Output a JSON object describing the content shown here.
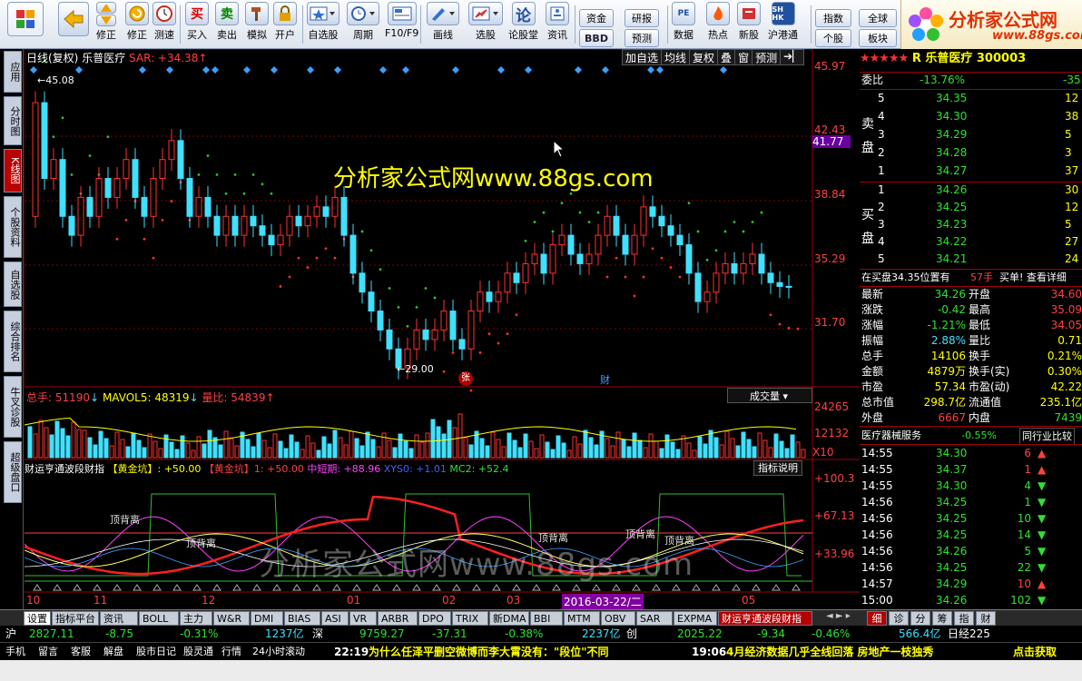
{
  "toolbar": {
    "buttons": [
      {
        "label": "修正",
        "icon": "up-down-icon"
      },
      {
        "label": "测速",
        "icon": "clock-icon"
      },
      {
        "label": "买入",
        "icon": "buy-icon"
      },
      {
        "label": "卖出",
        "icon": "sell-icon"
      },
      {
        "label": "模拟",
        "icon": "hammer-icon"
      },
      {
        "label": "开户",
        "icon": "lock-icon"
      },
      {
        "label": "自选股",
        "icon": "star-icon"
      },
      {
        "label": "周期",
        "icon": "period-icon"
      },
      {
        "label": "F10/F9",
        "icon": "f10-icon"
      },
      {
        "label": "画线",
        "icon": "pen-icon"
      },
      {
        "label": "选股",
        "icon": "select-icon"
      },
      {
        "label": "论股堂",
        "icon": "lun-icon"
      },
      {
        "label": "资讯",
        "icon": "news-icon"
      },
      {
        "label": "数据",
        "icon": "data-icon"
      },
      {
        "label": "热点",
        "icon": "hot-icon"
      },
      {
        "label": "新股",
        "icon": "newstock-icon"
      },
      {
        "label": "沪港通",
        "icon": "hk-icon"
      }
    ],
    "buy_glyph": "买",
    "sell_glyph": "卖",
    "lun_glyph": "论",
    "bbd_glyph": "BBD",
    "small_buttons": {
      "zijin": "资金",
      "yanbao": "研报",
      "bbd": "BBD",
      "yuce": "预测",
      "zhishu": "指数",
      "quanqiu": "全球",
      "gegu": "个股",
      "bankuai": "板块"
    },
    "logo_text": "分析家公式网",
    "logo_url": "www.88gs.com"
  },
  "left_strip": [
    "应用",
    "分时图",
    "K线图",
    "个股资料",
    "自选股",
    "综合排名",
    "牛叉诊股",
    "超级盘口"
  ],
  "chart": {
    "header": {
      "period": "日线(复权)",
      "name": "乐普医疗",
      "sar": "SAR: +34.38"
    },
    "buttons": [
      "加自选",
      "均线",
      "复权",
      "叠",
      "窗",
      "预测"
    ],
    "price_axis": [
      "45.97",
      "42.43",
      "41.77",
      "38.84",
      "35.29",
      "31.70"
    ],
    "high_label": "45.08",
    "low_label": "29.00",
    "watermark": "分析家公式网www.88gs.com",
    "watermark2": "分析家公式网www.88gs.com",
    "zhang_badge": "张",
    "cai_badge": "财",
    "vol_header": {
      "total": "总手: 51190",
      "mavol": "MAVOL5: 48319",
      "ratio": "量比: 54839"
    },
    "vol_selector": "成交量",
    "vol_axis": [
      "24265",
      "12132",
      "X10"
    ],
    "ind_header": {
      "name": "财运亨通波段财指",
      "a": "【黄金坑】: +50.00",
      "b": "【黄金坑】1: +50.00",
      "c": "中短期: +88.96",
      "d": "XYS0: +1.01",
      "e": "MC2: +52.4"
    },
    "ind_button": "指标说明",
    "ind_axis": [
      "+100.3",
      "+67.13",
      "+33.96"
    ],
    "ind_labels": [
      "顶背离",
      "顶背离",
      "顶背离",
      "顶背离",
      "顶背离"
    ],
    "date_axis": [
      "10",
      "11",
      "12",
      "01",
      "02",
      "03",
      "05"
    ],
    "date_highlight": "2016-03-22/二"
  },
  "chart_data": {
    "type": "candlestick",
    "title": "乐普医疗 日线(复权)",
    "price_range": [
      29.0,
      45.97
    ],
    "high": 45.08,
    "low": 29.0,
    "indicator_range": [
      0,
      100.3
    ],
    "x_ticks": [
      "10",
      "11",
      "12",
      "01",
      "02",
      "03",
      "05"
    ]
  },
  "right_panel": {
    "title": "R 乐普医疗",
    "code": "300003",
    "weibi_label": "委比",
    "weibi": "-13.76%",
    "weicha": "-35",
    "sell": [
      {
        "lvl": "5",
        "p": "34.35",
        "v": "12"
      },
      {
        "lvl": "4",
        "p": "34.30",
        "v": "38"
      },
      {
        "lvl": "3",
        "p": "34.29",
        "v": "5"
      },
      {
        "lvl": "2",
        "p": "34.28",
        "v": "3"
      },
      {
        "lvl": "1",
        "p": "34.27",
        "v": "37"
      }
    ],
    "buy": [
      {
        "lvl": "1",
        "p": "34.26",
        "v": "30"
      },
      {
        "lvl": "2",
        "p": "34.25",
        "v": "12"
      },
      {
        "lvl": "3",
        "p": "34.23",
        "v": "5"
      },
      {
        "lvl": "4",
        "p": "34.22",
        "v": "27"
      },
      {
        "lvl": "5",
        "p": "34.21",
        "v": "24"
      }
    ],
    "sell_label": "卖盘",
    "buy_label": "买盘",
    "notice": "在买盘34.35位置有",
    "notice_v": "57手",
    "notice_btn": "买单! 查看详细",
    "stats": [
      [
        "最新",
        "34.26",
        "开盘",
        "34.60"
      ],
      [
        "涨跌",
        "-0.42",
        "最高",
        "35.09"
      ],
      [
        "涨幅",
        "-1.21%",
        "最低",
        "34.05"
      ],
      [
        "振幅",
        "2.88%",
        "量比",
        "0.71"
      ],
      [
        "总手",
        "14106",
        "换手",
        "0.21%"
      ],
      [
        "金额",
        "4879万",
        "换手(实)",
        "0.30%"
      ],
      [
        "市盈",
        "57.34",
        "市盈(动)",
        "42.22"
      ],
      [
        "总市值",
        "298.7亿",
        "流通值",
        "235.1亿"
      ],
      [
        "外盘",
        "6667",
        "内盘",
        "7439"
      ]
    ],
    "industry": "医疗器械服务",
    "industry_chg": "-0.55%",
    "industry_btn": "同行业比较",
    "ticks": [
      {
        "t": "14:55",
        "p": "34.30",
        "v": "6",
        "d": "up"
      },
      {
        "t": "14:55",
        "p": "34.37",
        "v": "1",
        "d": "up"
      },
      {
        "t": "14:55",
        "p": "34.30",
        "v": "4",
        "d": "down"
      },
      {
        "t": "14:56",
        "p": "34.25",
        "v": "1",
        "d": "down"
      },
      {
        "t": "14:56",
        "p": "34.25",
        "v": "10",
        "d": "down"
      },
      {
        "t": "14:56",
        "p": "34.25",
        "v": "14",
        "d": "down"
      },
      {
        "t": "14:56",
        "p": "34.26",
        "v": "5",
        "d": "down"
      },
      {
        "t": "14:56",
        "p": "34.25",
        "v": "22",
        "d": "down"
      },
      {
        "t": "14:57",
        "p": "34.29",
        "v": "10",
        "d": "up"
      },
      {
        "t": "15:00",
        "p": "34.26",
        "v": "102",
        "d": "down"
      }
    ],
    "bottom_tabs": [
      "细",
      "诊",
      "分",
      "筹",
      "指",
      "财"
    ]
  },
  "tabs": [
    "设置",
    "指标平台",
    "资讯",
    "BOLL",
    "主力",
    "W&R",
    "DMI",
    "BIAS",
    "ASI",
    "VR",
    "ARBR",
    "DPO",
    "TRIX",
    "新DMA",
    "BBI",
    "MTM",
    "OBV",
    "SAR",
    "EXPMA",
    "财运亨通波段财指"
  ],
  "index_bar": {
    "sh_label": "沪",
    "sh": "2827.11",
    "sh_chg": "-8.75",
    "sh_pct": "-0.31%",
    "sh_amt": "1237亿",
    "sz_label": "深",
    "sz": "9759.27",
    "sz_chg": "-37.31",
    "sz_pct": "-0.38%",
    "sz_amt": "2237亿",
    "cy_label": "创",
    "cy": "2025.22",
    "cy_chg": "-9.34",
    "cy_pct": "-0.46%",
    "cy_amt": "566.4亿",
    "rj": "日经225"
  },
  "status": {
    "buttons": [
      "手机",
      "留言",
      "客服",
      "解盘",
      "股市日记",
      "股灵通",
      "行情",
      "24小时滚动"
    ],
    "news1_time": "22:19",
    "news1": "为什么任泽平删空微博而李大霄没有：\"段位\"不同",
    "news2_time": "19:06",
    "news2": "4月经济数据几乎全线回落 房地产一枝独秀",
    "right": "点击获取"
  }
}
